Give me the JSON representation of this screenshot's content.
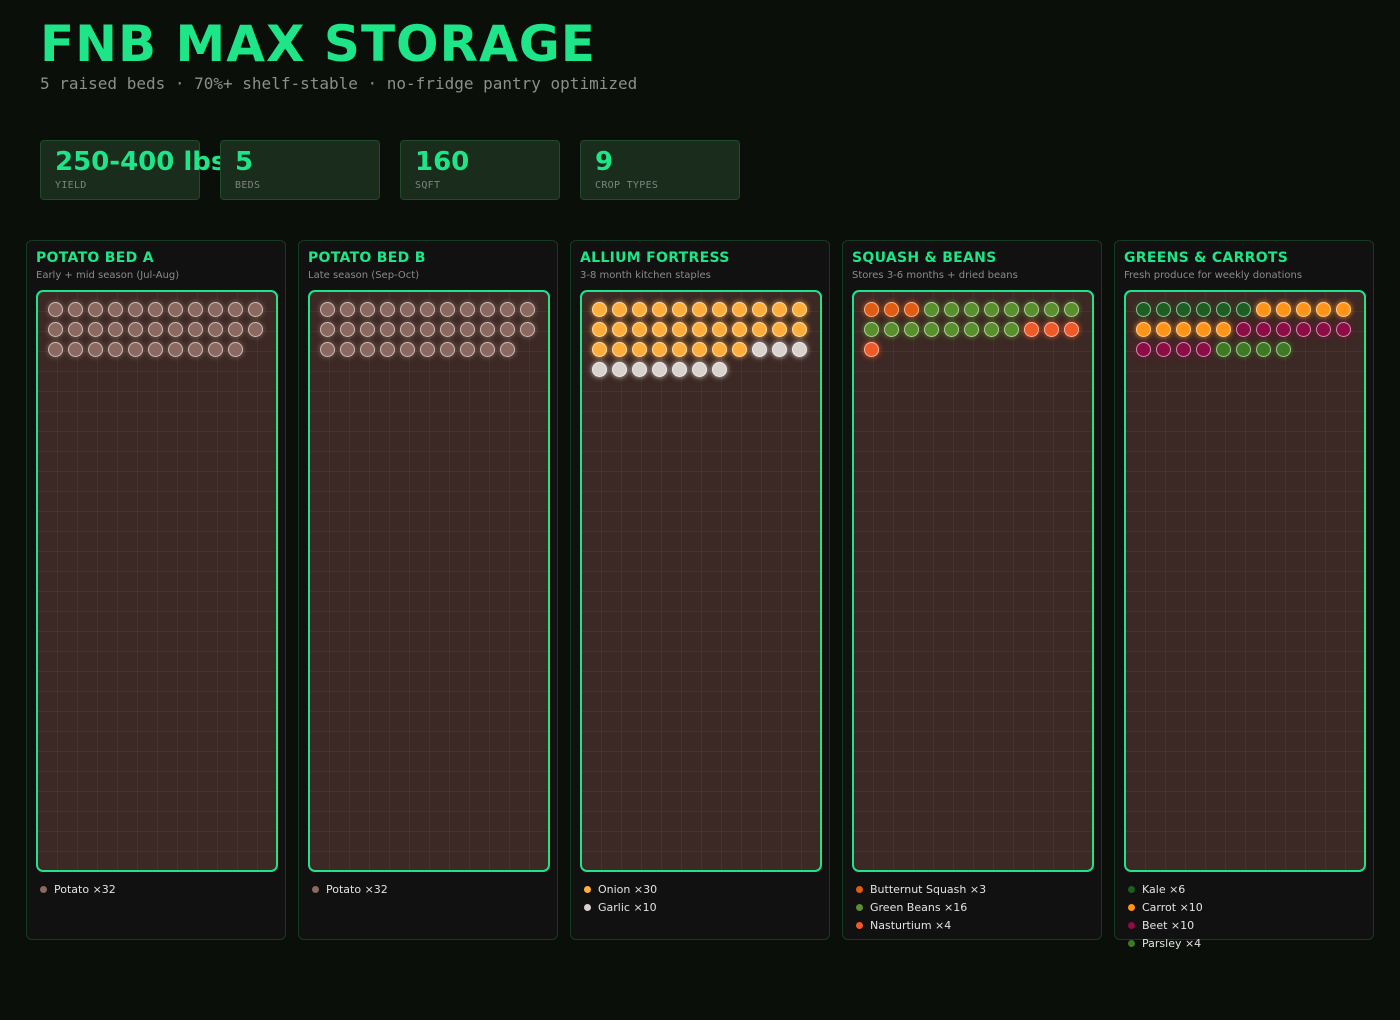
{
  "header": {
    "title": "FNB MAX STORAGE",
    "subtitle": "5 raised beds · 70%+ shelf-stable · no-fridge pantry optimized"
  },
  "stats": [
    {
      "value": "250-400 lbs",
      "label": "YIELD"
    },
    {
      "value": "5",
      "label": "BEDS"
    },
    {
      "value": "160",
      "label": "SQFT"
    },
    {
      "value": "9",
      "label": "CROP TYPES"
    }
  ],
  "colors": {
    "accent": "#1de588",
    "potato": "#8a6a60",
    "onion": "#ffad3b",
    "garlic": "#d9d2cf",
    "butternut_squash": "#e05c12",
    "green_beans": "#5a8f2e",
    "nasturtium": "#f05a28",
    "kale": "#1d5f22",
    "carrot": "#ff9418",
    "beet": "#8c0c45",
    "parsley": "#3d7a22"
  },
  "beds": [
    {
      "title": "POTATO BED A",
      "subtitle": "Early + mid season (Jul-Aug)",
      "crops": [
        {
          "label": "Potato ×32",
          "count": 32,
          "color": "#8a6a60",
          "icon": "potato-icon"
        }
      ]
    },
    {
      "title": "POTATO BED B",
      "subtitle": "Late season (Sep-Oct)",
      "crops": [
        {
          "label": "Potato ×32",
          "count": 32,
          "color": "#8a6a60",
          "icon": "potato-icon"
        }
      ]
    },
    {
      "title": "ALLIUM FORTRESS",
      "subtitle": "3-8 month kitchen staples",
      "crops": [
        {
          "label": "Onion ×30",
          "count": 30,
          "color": "#ffad3b",
          "icon": "onion-icon"
        },
        {
          "label": "Garlic ×10",
          "count": 10,
          "color": "#d9d2cf",
          "icon": "garlic-icon"
        }
      ]
    },
    {
      "title": "SQUASH & BEANS",
      "subtitle": "Stores 3-6 months + dried beans",
      "crops": [
        {
          "label": "Butternut Squash ×3",
          "count": 3,
          "color": "#e05c12",
          "icon": "squash-icon"
        },
        {
          "label": "Green Beans ×16",
          "count": 16,
          "color": "#5a8f2e",
          "icon": "bean-icon"
        },
        {
          "label": "Nasturtium ×4",
          "count": 4,
          "color": "#f05a28",
          "icon": "nasturtium-icon"
        }
      ]
    },
    {
      "title": "GREENS & CARROTS",
      "subtitle": "Fresh produce for weekly donations",
      "crops": [
        {
          "label": "Kale ×6",
          "count": 6,
          "color": "#1d5f22",
          "icon": "kale-icon"
        },
        {
          "label": "Carrot ×10",
          "count": 10,
          "color": "#ff9418",
          "icon": "carrot-icon"
        },
        {
          "label": "Beet ×10",
          "count": 10,
          "color": "#8c0c45",
          "icon": "beet-icon"
        },
        {
          "label": "Parsley ×4",
          "count": 4,
          "color": "#3d7a22",
          "icon": "parsley-icon"
        }
      ]
    }
  ]
}
